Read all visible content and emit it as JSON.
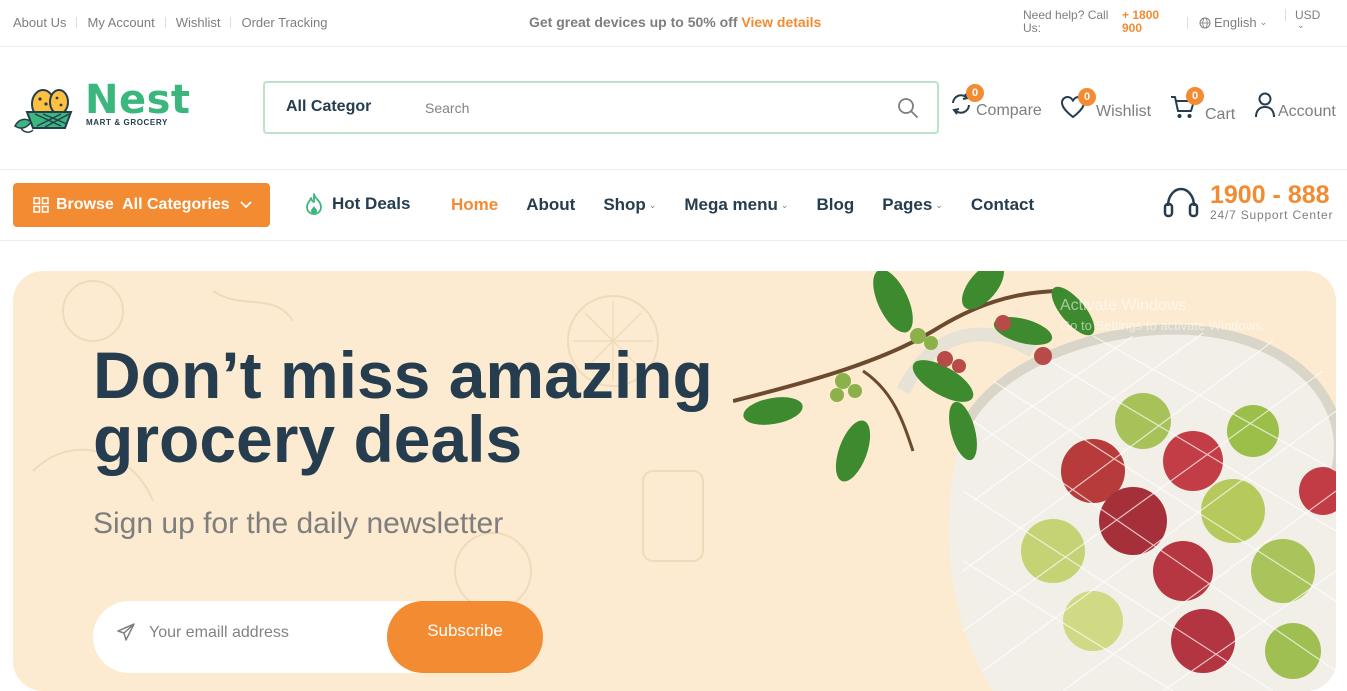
{
  "topbar": {
    "links": [
      "About Us",
      "My Account",
      "Wishlist",
      "Order Tracking"
    ],
    "promo_text": "Get great devices up to 50% off",
    "promo_link": "View details",
    "help_text": "Need help? Call Us:",
    "help_phone": "+ 1800 900",
    "language": "English",
    "currency": "USD"
  },
  "header": {
    "logo_name": "Nest",
    "logo_tagline": "MART & GROCERY",
    "search": {
      "category": "All Categor",
      "placeholder": "Search"
    },
    "actions": [
      {
        "label": "Compare",
        "count": "0",
        "icon": "compare-icon"
      },
      {
        "label": "Wishlist",
        "count": "0",
        "icon": "heart-icon"
      },
      {
        "label": "Cart",
        "count": "0",
        "icon": "cart-icon"
      },
      {
        "label": "Account",
        "icon": "user-icon"
      }
    ]
  },
  "nav": {
    "browse_label": "Browse  All Categories",
    "hot_deals": "Hot Deals",
    "menu": [
      {
        "label": "Home",
        "active": true
      },
      {
        "label": "About"
      },
      {
        "label": "Shop",
        "has_dropdown": true
      },
      {
        "label": "Mega menu",
        "has_dropdown": true
      },
      {
        "label": "Blog"
      },
      {
        "label": "Pages",
        "has_dropdown": true
      },
      {
        "label": "Contact"
      }
    ],
    "support_number": "1900 - 888",
    "support_label": "24/7 Support Center"
  },
  "hero": {
    "title": "Don’t miss amazing grocery deals",
    "subtitle": "Sign up for the daily newsletter",
    "email_placeholder": "Your emaill address",
    "subscribe_label": "Subscribe"
  },
  "watermark": {
    "line1": "Activate Windows",
    "line2": "Go to Settings to activate Windows."
  },
  "colors": {
    "accent": "#f28b32",
    "brand_green": "#3bb77e",
    "text_dark": "#253d4e",
    "hero_bg": "#fcebd0"
  }
}
